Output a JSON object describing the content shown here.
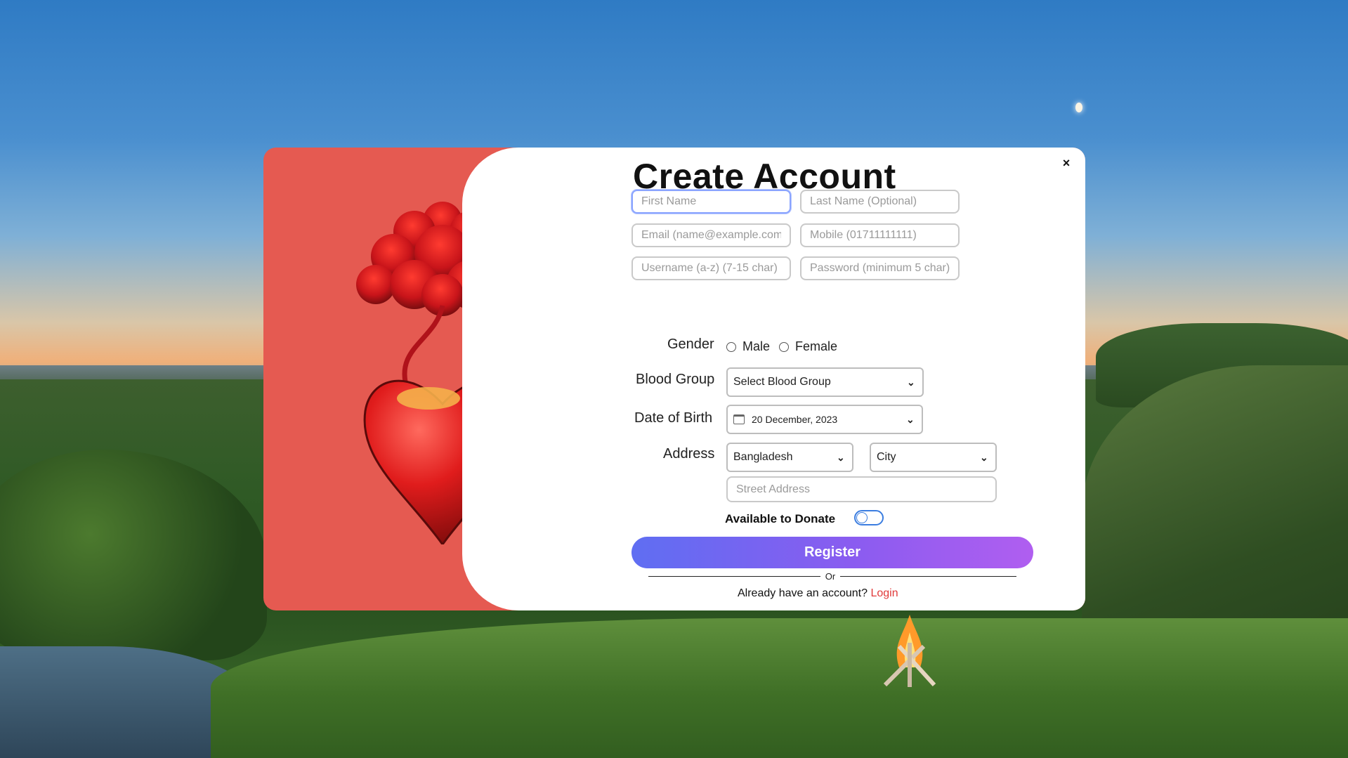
{
  "form": {
    "title": "Create Account",
    "close_label": "×",
    "placeholders": {
      "first_name": "First Name",
      "last_name": "Last Name (Optional)",
      "email": "Email (name@example.com)",
      "mobile": "Mobile (01711111111)",
      "username": "Username (a-z) (7-15 char)",
      "password": "Password (minimum 5 char)",
      "street": "Street Address"
    },
    "gender": {
      "label": "Gender",
      "options": [
        "Male",
        "Female"
      ]
    },
    "blood_group": {
      "label": "Blood Group",
      "selected": "Select Blood Group"
    },
    "dob": {
      "label": "Date of Birth",
      "value": "20 December, 2023"
    },
    "address": {
      "label": "Address",
      "country": "Bangladesh",
      "city": "City"
    },
    "donate": {
      "label": "Available to Donate",
      "enabled": false
    },
    "register_label": "Register",
    "or_label": "Or",
    "already_text": "Already have an account?",
    "login_label": "Login"
  },
  "icons": {
    "close": "close-icon",
    "calendar": "calendar-icon",
    "chevron": "chevron-down-icon"
  },
  "colors": {
    "accent_left_panel": "#e55a51",
    "register_gradient_start": "#5f6ef2",
    "register_gradient_end": "#b05ef0",
    "login_link": "#e03a3a",
    "toggle": "#3b7de0"
  }
}
